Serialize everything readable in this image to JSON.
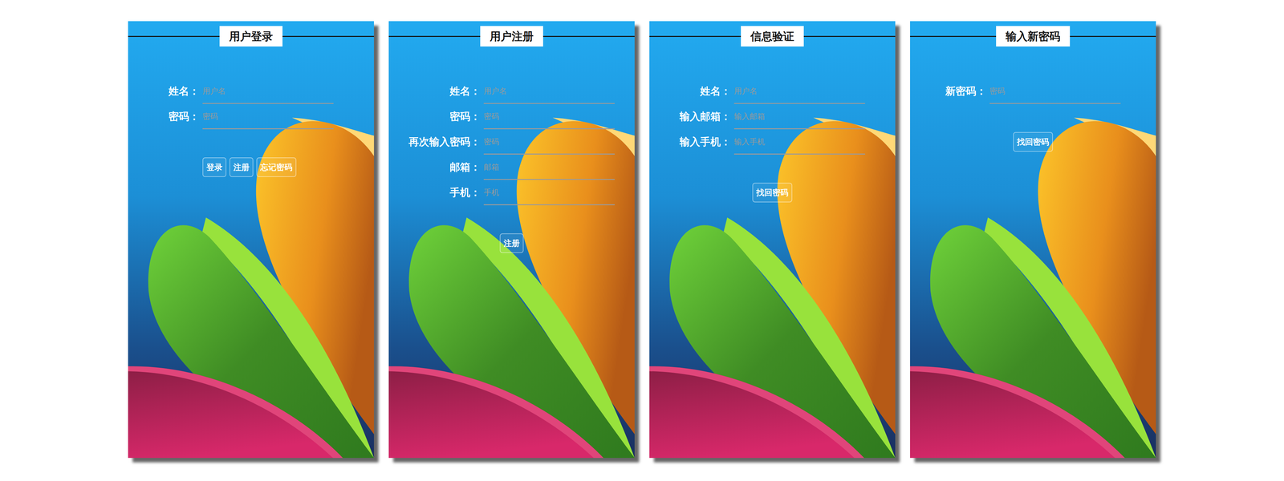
{
  "panels": [
    {
      "title": "用户登录",
      "fields": [
        {
          "label": "姓名：",
          "placeholder": "用户名"
        },
        {
          "label": "密码：",
          "placeholder": "密码"
        }
      ],
      "buttons": [
        "登录",
        "注册",
        "忘记密码"
      ]
    },
    {
      "title": "用户注册",
      "fields": [
        {
          "label": "姓名：",
          "placeholder": "用户名"
        },
        {
          "label": "密码：",
          "placeholder": "密码"
        },
        {
          "label": "再次输入密码：",
          "placeholder": "密码"
        },
        {
          "label": "邮箱：",
          "placeholder": "邮箱"
        },
        {
          "label": "手机：",
          "placeholder": "手机"
        }
      ],
      "buttons": [
        "注册"
      ]
    },
    {
      "title": "信息验证",
      "fields": [
        {
          "label": "姓名：",
          "placeholder": "用户名"
        },
        {
          "label": "输入邮箱：",
          "placeholder": "输入邮箱"
        },
        {
          "label": "输入手机：",
          "placeholder": "输入手机"
        }
      ],
      "buttons": [
        "找回密码"
      ]
    },
    {
      "title": "输入新密码",
      "fields": [
        {
          "label": "新密码：",
          "placeholder": "密码"
        }
      ],
      "buttons": [
        "找回密码"
      ]
    }
  ]
}
